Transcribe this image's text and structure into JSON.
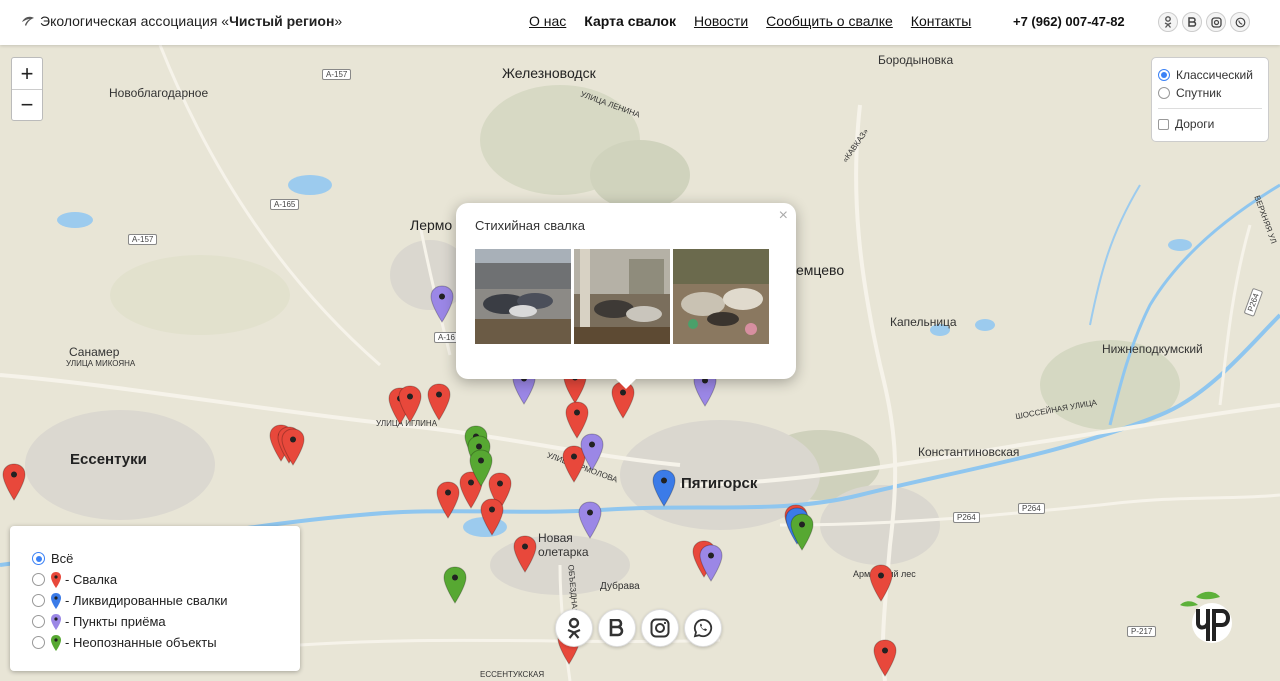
{
  "header": {
    "brand_prefix": "Экологическая ассоциация «",
    "brand_name": "Чистый регион",
    "brand_suffix": "»",
    "nav": [
      "О нас",
      "Карта свалок",
      "Новости",
      "Сообщить о свалке",
      "Контакты"
    ],
    "active_nav": "Карта свалок",
    "phone": "+7 (962) 007-47-82"
  },
  "map": {
    "zoom_in": "+",
    "zoom_out": "−",
    "layers": {
      "classic": "Классический",
      "satellite": "Спутник",
      "roads": "Дороги",
      "selected": "Классический",
      "roads_checked": false
    },
    "places": {
      "zheleznovodsk": "Железноводск",
      "borodynovka": "Бородыновка",
      "novoblagodarnoe": "Новоблагодарное",
      "lermontov": "Лермо",
      "inozemtsevo": "емцево",
      "kapelnitsa": "Капельница",
      "nizhnepodkumsky": "Нижнеподкумский",
      "sanamer": "Санамер",
      "ulitsa_mikoyana": "УЛИЦА МИКОЯНА",
      "ulitsa_lenina": "УЛИЦА ЛЕНИНА",
      "ulitsa_yermolova": "УЛИЦА ЕРМОЛОВА",
      "ulitsa_iglina": "УЛИЦА ИГЛИНА",
      "yessentuki": "Ессентуки",
      "pyatigorsk": "Пятигорск",
      "konstantinovskaya": "Константиновская",
      "novaya_voletarka": "Новая\nолетарка",
      "dubrava": "Дубрава",
      "armyansky_les": "Армянский лес",
      "kavkaz": "«КАВКАЗ»",
      "shosseynaya": "ШОССЕЙНАЯ УЛИЦА",
      "essentukskaya": "ЕССЕНТУКСКАЯ",
      "obezdnaya": "ОБЪЕЗДНАЯ",
      "verkhnyaya": "ВЕРХНЯЯ УЛ"
    },
    "roads": [
      "А-157",
      "А-165",
      "А-157",
      "А-16",
      "Р264",
      "Р264",
      "Р264",
      "Р-217"
    ],
    "popup": {
      "title": "Стихийная свалка",
      "close": "×",
      "photo_count": 3
    },
    "pins": {
      "colors": {
        "dump": "#e8483b",
        "cleared": "#3b7be8",
        "reception": "#9b87e6",
        "unknown": "#57a832"
      }
    }
  },
  "legend": {
    "all": "Всё",
    "items": [
      {
        "label": "- Свалка",
        "type": "dump"
      },
      {
        "label": "- Ликвидированные свалки",
        "type": "cleared"
      },
      {
        "label": "- Пункты приёма",
        "type": "reception"
      },
      {
        "label": "- Неопознанные объекты",
        "type": "unknown"
      }
    ],
    "selected": "Всё"
  },
  "social": [
    "odnoklassniki-icon",
    "vk-icon",
    "instagram-icon",
    "whatsapp-icon"
  ]
}
